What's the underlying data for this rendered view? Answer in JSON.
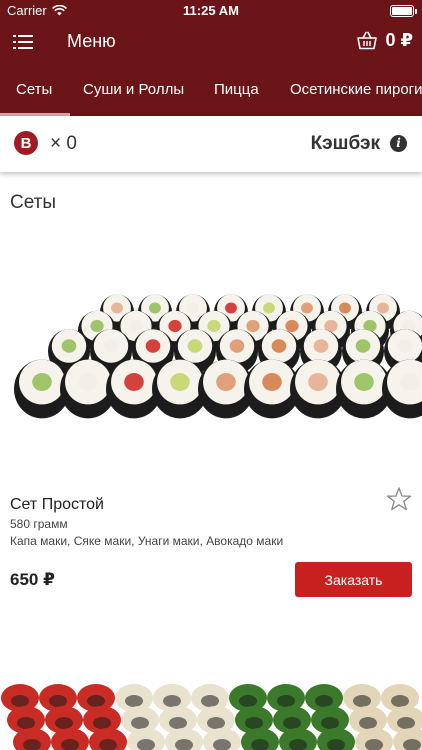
{
  "status_bar": {
    "carrier": "Carrier",
    "time": "11:25 AM"
  },
  "nav": {
    "title": "Меню",
    "cart_total": "0 ₽"
  },
  "tabs": [
    {
      "label": "Сеты",
      "active": true
    },
    {
      "label": "Суши и Роллы",
      "active": false
    },
    {
      "label": "Пицца",
      "active": false
    },
    {
      "label": "Осетинские пироги",
      "active": false
    }
  ],
  "bonus": {
    "coin_letter": "B",
    "count": "× 0",
    "cashback_label": "Кэшбэк"
  },
  "section": {
    "title": "Сеты"
  },
  "product": {
    "name": "Сет Простой",
    "weight": "580 грамм",
    "description": "Капа маки, Сяке маки, Унаги маки, Авокадо маки",
    "price": "650 ₽",
    "order_label": "Заказать"
  },
  "colors": {
    "brand": "#6b1518",
    "accent": "#c8201f",
    "coin": "#a01c22"
  }
}
